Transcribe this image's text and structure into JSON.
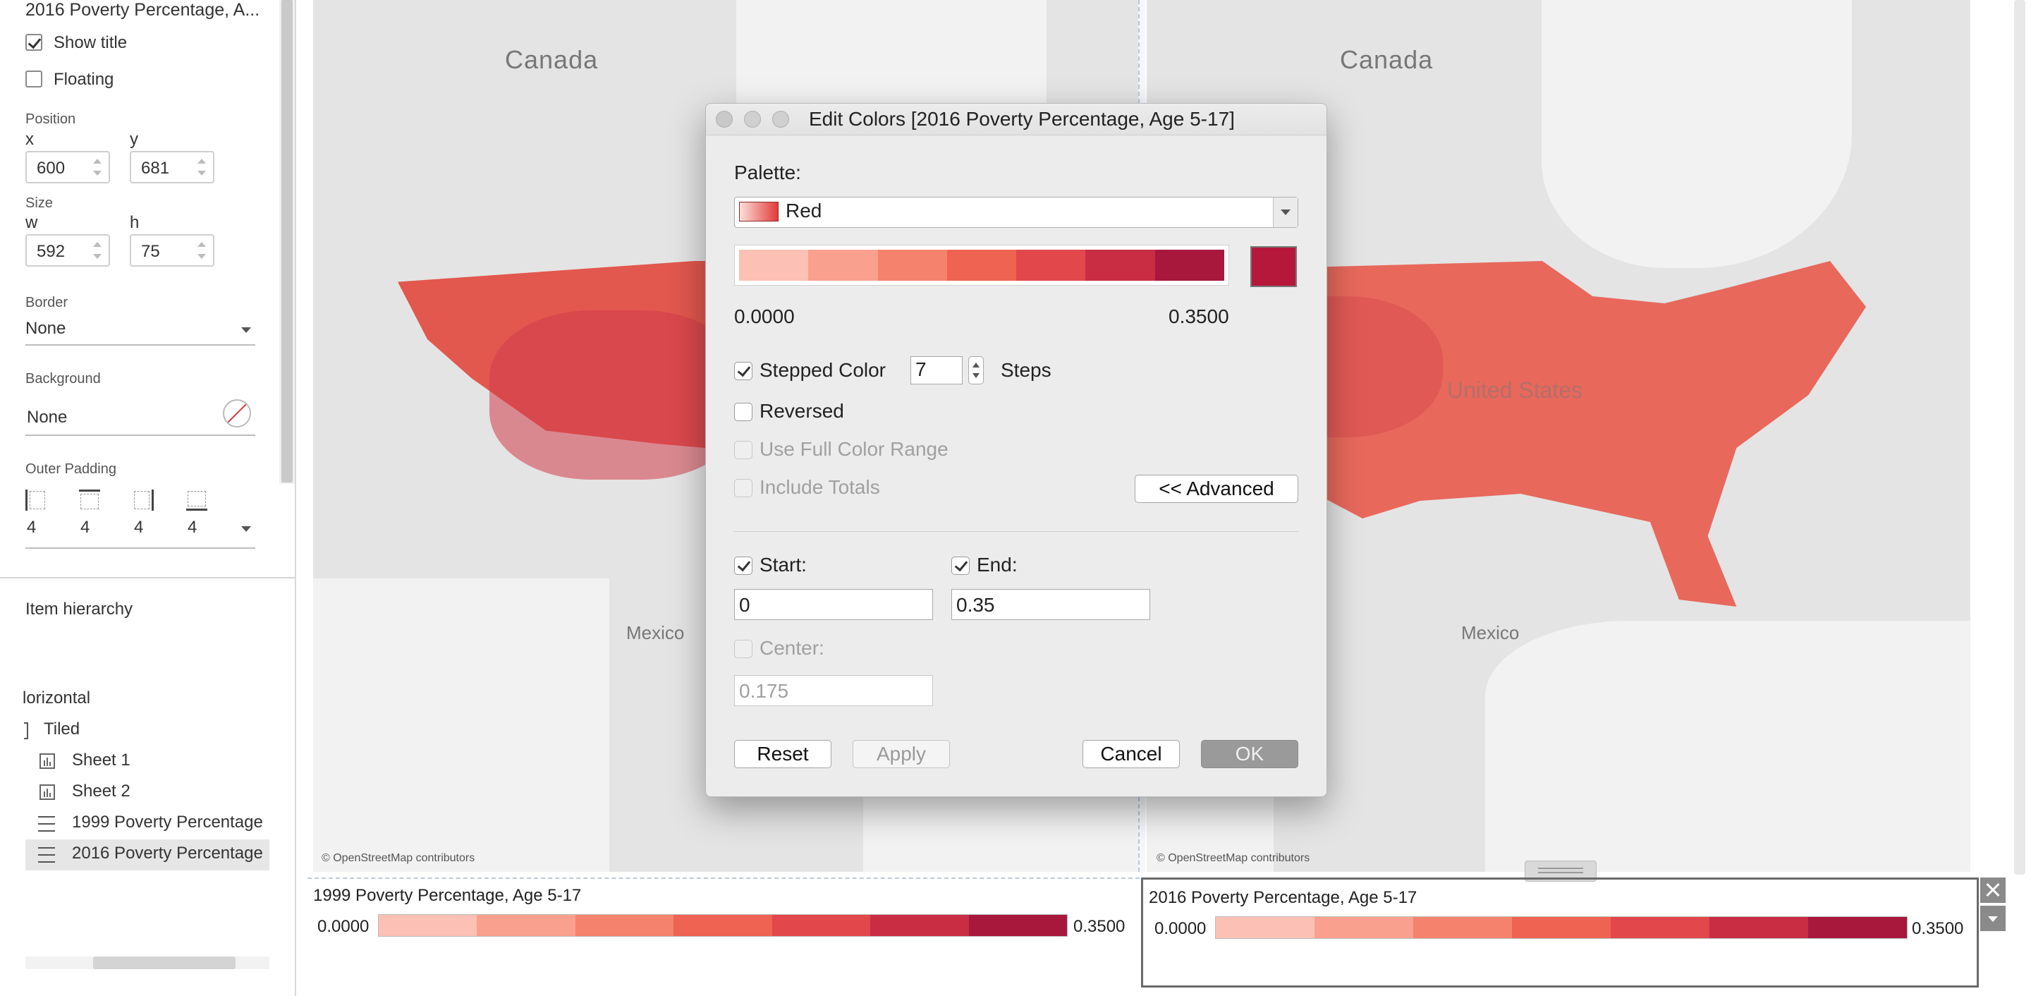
{
  "left_panel": {
    "title": "2016 Poverty Percentage, A...",
    "show_title_label": "Show title",
    "show_title_checked": true,
    "floating_label": "Floating",
    "floating_checked": false,
    "position_label": "Position",
    "x_label": "x",
    "x_value": "600",
    "y_label": "y",
    "y_value": "681",
    "size_label": "Size",
    "w_label": "w",
    "w_value": "592",
    "h_label": "h",
    "h_value": "75",
    "border_label": "Border",
    "border_value": "None",
    "background_label": "Background",
    "background_value": "None",
    "outer_padding_label": "Outer Padding",
    "padding_values": [
      "4",
      "4",
      "4",
      "4"
    ],
    "item_hierarchy_label": "Item hierarchy",
    "tree": {
      "horizontal": "lorizontal",
      "tiled": "Tiled",
      "items": [
        "Sheet 1",
        "Sheet 2",
        "1999 Poverty Percentage",
        "2016 Poverty Percentage"
      ]
    }
  },
  "maps": {
    "canada_label": "Canada",
    "mexico_label": "Mexico",
    "us_label": "United States",
    "attribution": "© OpenStreetMap contributors"
  },
  "legends": [
    {
      "title": "1999 Poverty Percentage, Age 5-17",
      "min": "0.0000",
      "max": "0.3500"
    },
    {
      "title": "2016 Poverty Percentage, Age 5-17",
      "min": "0.0000",
      "max": "0.3500"
    }
  ],
  "palette_colors": [
    "#fcc0b4",
    "#f9a08f",
    "#f5826d",
    "#ee6352",
    "#e1474b",
    "#c82d44",
    "#a8183d"
  ],
  "dialog": {
    "title": "Edit Colors [2016 Poverty Percentage, Age 5-17]",
    "palette_label": "Palette:",
    "palette_value": "Red",
    "range_min": "0.0000",
    "range_max": "0.3500",
    "stepped_color_label": "Stepped Color",
    "stepped_color_checked": true,
    "steps_value": "7",
    "steps_label": "Steps",
    "reversed_label": "Reversed",
    "use_full_range_label": "Use Full Color Range",
    "include_totals_label": "Include Totals",
    "advanced_button": "<< Advanced",
    "start_label": "Start:",
    "start_value": "0",
    "end_label": "End:",
    "end_value": "0.35",
    "center_label": "Center:",
    "center_value": "0.175",
    "reset_button": "Reset",
    "apply_button": "Apply",
    "cancel_button": "Cancel",
    "ok_button": "OK",
    "end_swatch_color": "#b5183b"
  }
}
